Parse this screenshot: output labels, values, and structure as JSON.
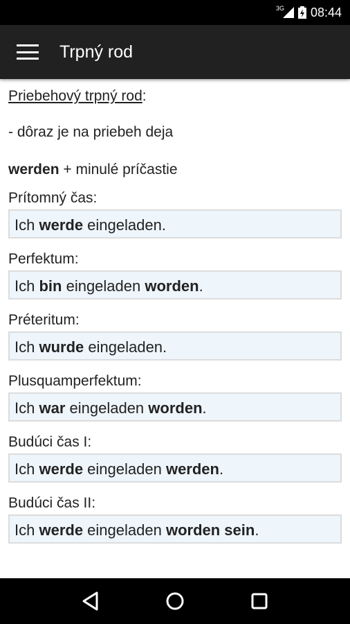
{
  "status_bar": {
    "network": "3G",
    "time": "08:44"
  },
  "app_bar": {
    "title": "Trpný rod"
  },
  "content": {
    "section_title": "Priebehový trpný rod",
    "section_colon": ":",
    "emphasis_line": "- dôraz je na priebeh deja",
    "formula": {
      "bold": "werden",
      "rest": " + minulé príčastie"
    },
    "tenses": [
      {
        "label": "Prítomný čas:",
        "example": [
          {
            "t": "Ich "
          },
          {
            "t": "werde",
            "b": true
          },
          {
            "t": " eingeladen."
          }
        ]
      },
      {
        "label": "Perfektum:",
        "example": [
          {
            "t": "Ich "
          },
          {
            "t": "bin",
            "b": true
          },
          {
            "t": " eingeladen "
          },
          {
            "t": "worden",
            "b": true
          },
          {
            "t": "."
          }
        ]
      },
      {
        "label": "Préteritum:",
        "example": [
          {
            "t": "Ich "
          },
          {
            "t": "wurde",
            "b": true
          },
          {
            "t": " eingeladen."
          }
        ]
      },
      {
        "label": "Plusquamperfektum:",
        "example": [
          {
            "t": "Ich "
          },
          {
            "t": "war",
            "b": true
          },
          {
            "t": " eingeladen "
          },
          {
            "t": "worden",
            "b": true
          },
          {
            "t": "."
          }
        ]
      },
      {
        "label": "Budúci čas I:",
        "example": [
          {
            "t": "Ich "
          },
          {
            "t": "werde",
            "b": true
          },
          {
            "t": " eingeladen "
          },
          {
            "t": "werden",
            "b": true
          },
          {
            "t": "."
          }
        ]
      },
      {
        "label": "Budúci čas II:",
        "example": [
          {
            "t": "Ich "
          },
          {
            "t": "werde",
            "b": true
          },
          {
            "t": " eingeladen "
          },
          {
            "t": "worden sein",
            "b": true
          },
          {
            "t": "."
          }
        ]
      }
    ]
  },
  "nav_bar": {
    "icons": [
      "back-icon",
      "home-icon",
      "recents-icon"
    ]
  }
}
